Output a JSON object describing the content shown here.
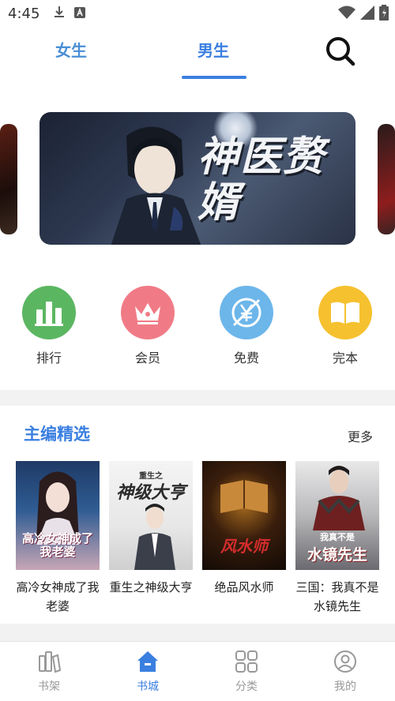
{
  "status_bar": {
    "time": "4:45"
  },
  "header": {
    "tabs": [
      {
        "label": "女生",
        "active": false
      },
      {
        "label": "男生",
        "active": true
      }
    ]
  },
  "banner": {
    "title": "神医赘婿"
  },
  "quick_entries": [
    {
      "label": "排行",
      "icon": "ranking-bars-icon",
      "color": "#5bb661"
    },
    {
      "label": "会员",
      "icon": "crown-icon",
      "color": "#f07b86"
    },
    {
      "label": "免费",
      "icon": "yen-free-icon",
      "color": "#6cb6ea"
    },
    {
      "label": "完本",
      "icon": "open-book-icon",
      "color": "#f6c12f"
    }
  ],
  "editor_picks": {
    "title": "主编精选",
    "more_label": "更多",
    "books": [
      {
        "title": "高冷女神成了我老婆",
        "cover_text": "高冷女神成了我老婆"
      },
      {
        "title": "重生之神级大亨",
        "cover_text": "神级大亨",
        "cover_sub": "重生之"
      },
      {
        "title": "绝品风水师",
        "cover_text": "风水师"
      },
      {
        "title": "三国：我真不是水镜先生",
        "cover_text": "水镜先生",
        "cover_sub": "我真不是"
      }
    ]
  },
  "bottom_nav": [
    {
      "label": "书架",
      "icon": "bookshelf-icon",
      "active": false
    },
    {
      "label": "书城",
      "icon": "bookstore-home-icon",
      "active": true
    },
    {
      "label": "分类",
      "icon": "category-grid-icon",
      "active": false
    },
    {
      "label": "我的",
      "icon": "profile-icon",
      "active": false
    }
  ],
  "colors": {
    "accent": "#3a7fe0",
    "divider": "#f2f2f2"
  }
}
